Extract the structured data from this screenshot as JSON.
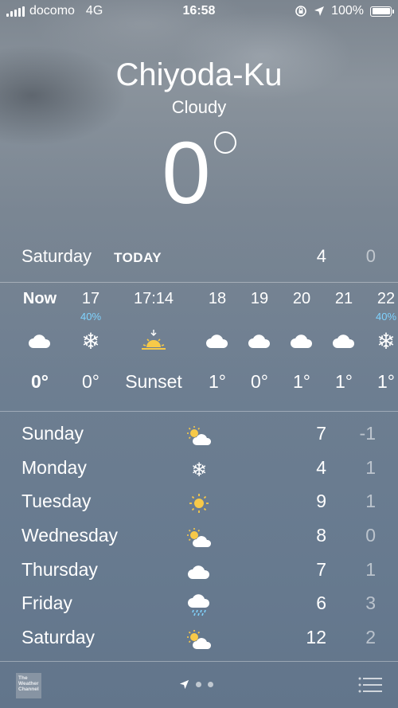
{
  "status": {
    "carrier": "docomo",
    "network": "4G",
    "time": "16:58",
    "battery": "100%",
    "icons": [
      "signal-bars-icon",
      "orientation-lock-icon",
      "location-arrow-icon",
      "battery-icon"
    ]
  },
  "location": {
    "city": "Chiyoda-Ku",
    "condition": "Cloudy",
    "current_temp": "0"
  },
  "today": {
    "day": "Saturday",
    "tag": "TODAY",
    "high": "4",
    "low": "0"
  },
  "hourly": [
    {
      "time": "Now",
      "precip": "",
      "icon": "cloud-icon",
      "value": "0°"
    },
    {
      "time": "17",
      "precip": "40%",
      "icon": "snowflake-icon",
      "value": "0°"
    },
    {
      "time": "17:14",
      "precip": "",
      "icon": "sunset-icon",
      "value": "Sunset"
    },
    {
      "time": "18",
      "precip": "",
      "icon": "cloud-icon",
      "value": "1°"
    },
    {
      "time": "19",
      "precip": "",
      "icon": "cloud-icon",
      "value": "0°"
    },
    {
      "time": "20",
      "precip": "",
      "icon": "cloud-icon",
      "value": "1°"
    },
    {
      "time": "21",
      "precip": "",
      "icon": "cloud-icon",
      "value": "1°"
    },
    {
      "time": "22",
      "precip": "40%",
      "icon": "snowflake-icon",
      "value": "1°"
    }
  ],
  "daily": [
    {
      "day": "Sunday",
      "icon": "partly-sunny-icon",
      "high": "7",
      "low": "-1"
    },
    {
      "day": "Monday",
      "icon": "snowflake-icon",
      "high": "4",
      "low": "1"
    },
    {
      "day": "Tuesday",
      "icon": "sun-icon",
      "high": "9",
      "low": "1"
    },
    {
      "day": "Wednesday",
      "icon": "partly-sunny-icon",
      "high": "8",
      "low": "0"
    },
    {
      "day": "Thursday",
      "icon": "cloud-icon",
      "high": "7",
      "low": "1"
    },
    {
      "day": "Friday",
      "icon": "rain-cloud-icon",
      "high": "6",
      "low": "3"
    },
    {
      "day": "Saturday",
      "icon": "partly-sunny-icon",
      "high": "12",
      "low": "2"
    }
  ],
  "bottom": {
    "logo_text": "The Weather Channel",
    "icons": [
      "weather-channel-logo",
      "location-arrow-icon",
      "page-dot-icon",
      "list-icon"
    ]
  },
  "colors": {
    "precip": "#7fd3ff",
    "sun": "#f7c948",
    "low_temp_opacity": "0.55"
  }
}
